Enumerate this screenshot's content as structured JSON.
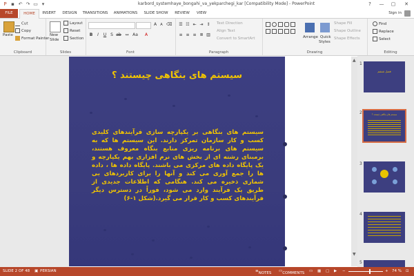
{
  "window": {
    "title": "karbord_systemhaye_bongahi_va_yekparchegi_kar [Compatibility Mode] - PowerPoint",
    "controls": [
      "?",
      "—",
      "▢",
      "✕"
    ]
  },
  "tabs": [
    "FILE",
    "HOME",
    "INSERT",
    "DESIGN",
    "TRANSITIONS",
    "ANIMATIONS",
    "SLIDE SHOW",
    "REVIEW",
    "VIEW"
  ],
  "active_tab": "HOME",
  "account": {
    "sign_in": "Sign in"
  },
  "ribbon": {
    "clipboard": {
      "paste": "Paste",
      "cut": "Cut",
      "copy": "Copy",
      "format_painter": "Format Painter",
      "label": "Clipboard"
    },
    "slides": {
      "new_slide": "New",
      "new_slide2": "Slide",
      "layout": "Layout",
      "reset": "Reset",
      "section": "Section",
      "label": "Slides"
    },
    "font": {
      "label": "Font"
    },
    "paragraph": {
      "text_direction": "Text Direction",
      "align_text": "Align Text",
      "convert_smartart": "Convert to SmartArt",
      "label": "Paragraph"
    },
    "drawing": {
      "arrange": "Arrange",
      "quick_styles": "Quick",
      "quick_styles2": "Styles",
      "shape_fill": "Shape Fill",
      "shape_outline": "Shape Outline",
      "shape_effects": "Shape Effects",
      "label": "Drawing"
    },
    "editing": {
      "find": "Find",
      "replace": "Replace",
      "select": "Select",
      "label": "Editing"
    }
  },
  "slide": {
    "title": "سیستم های بنگاهی چیستند ؟",
    "body": "سیستم های بنگاهی بر یکپارچه سازی فرآیندهای کلیدی کسب و کار سازمان تمرکز دارند. این سیستم ها که به سیستم های برنامه ریزی منابع بنگاه معروف هستند، برمبنای رشته ای از بخش های نرم افزاری بهم یکپارچه و یک پایگاه داده های مرکزی می باشند. پایگاه داده ها ، داده ها را جمع آوری می کند و آنها را برای کاربردهای بی شماری ذخیره می کند. هنگامی که اطلاعات جدیدی از طریق یک فرآیند وارد می شود، فوراً در دسترس دیگر فرآیندهای کسب و کار قرار می گیرد.(شکل ۱-۶)"
  },
  "thumbnails": [
    {
      "number": "1",
      "title": "فصل ششم"
    },
    {
      "number": "2",
      "title": "سیستم های بنگاهی چیستند ؟"
    },
    {
      "number": "3",
      "title": ""
    },
    {
      "number": "4",
      "title": ""
    },
    {
      "number": "5",
      "title": ""
    }
  ],
  "status": {
    "slide_info": "SLIDE 2 OF 48",
    "language": "PERSIAN",
    "notes": "NOTES",
    "comments": "COMMENTS",
    "zoom": "74 %"
  },
  "colors": {
    "accent": "#b7472a",
    "slide_bg": "#3d3f82",
    "slide_text": "#f2c500"
  }
}
